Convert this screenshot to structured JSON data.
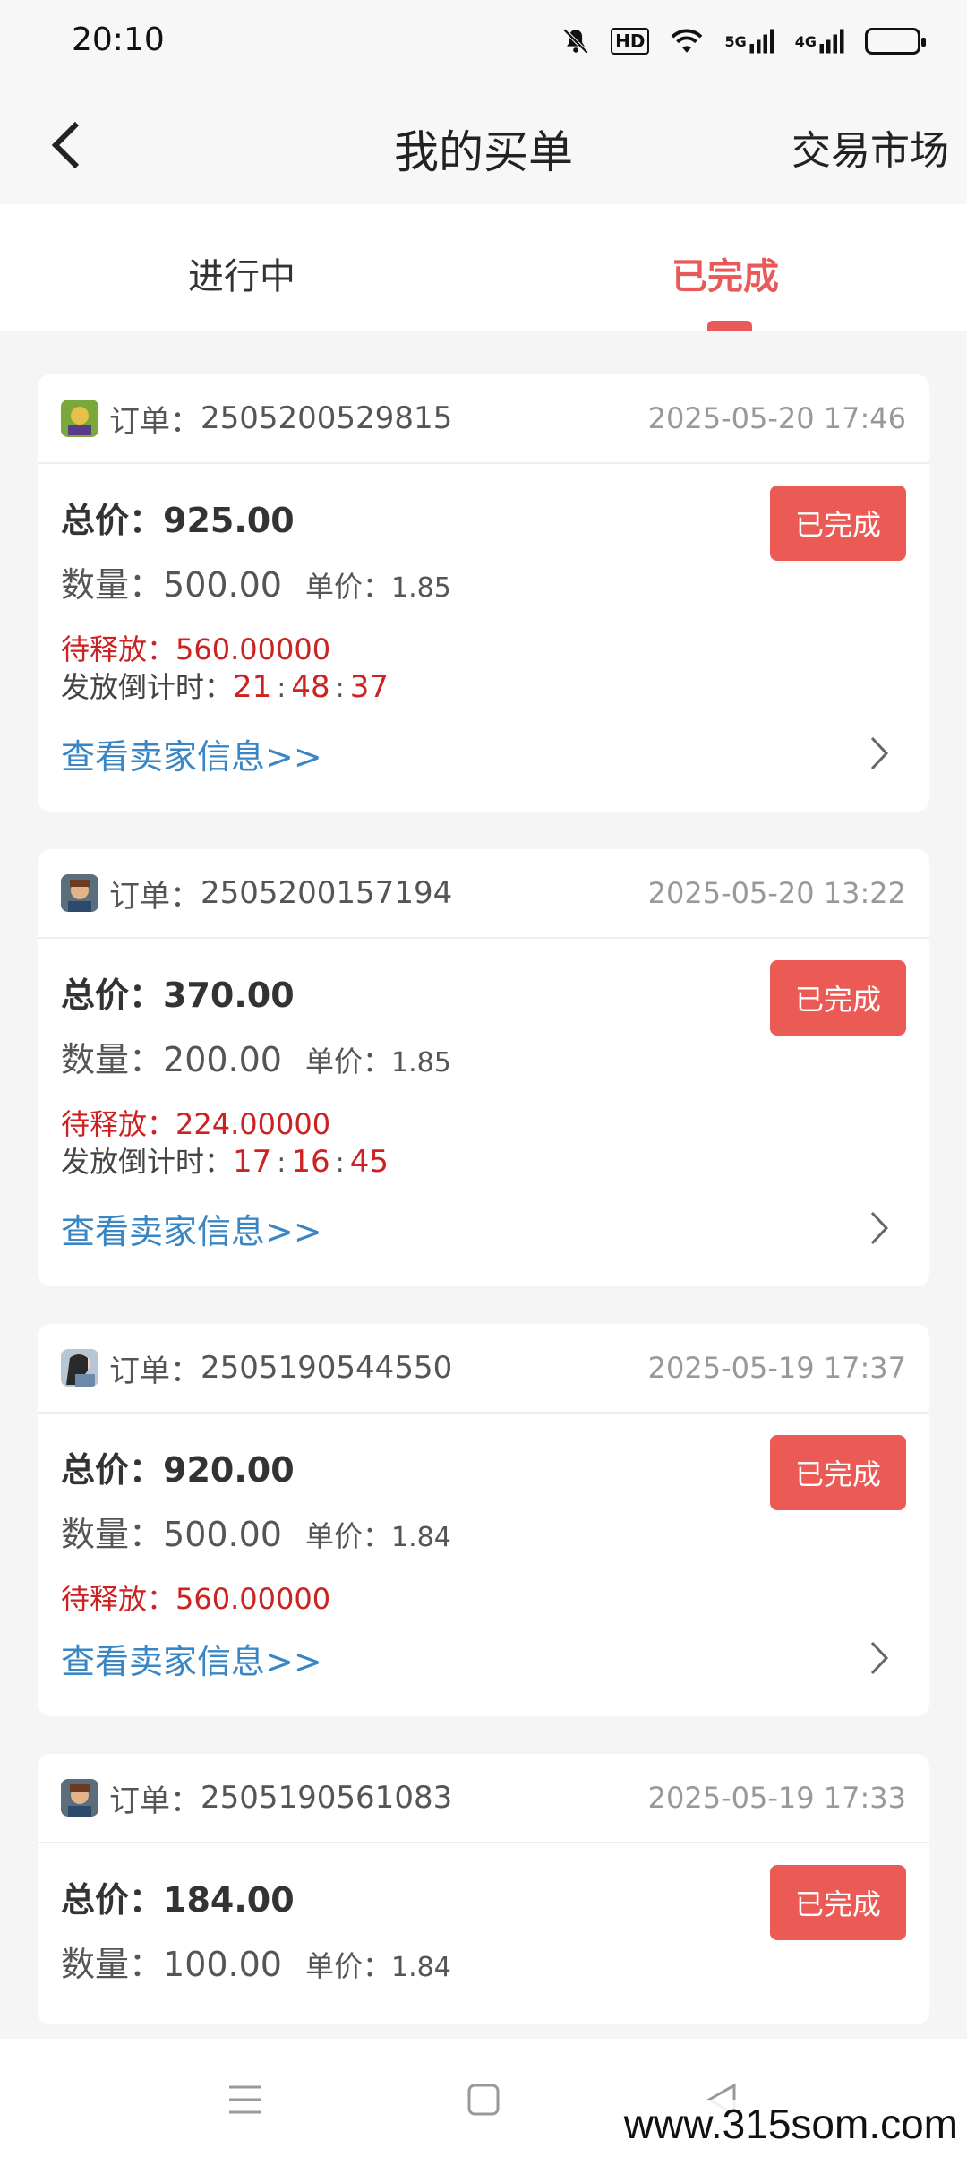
{
  "status_bar": {
    "time": "20:10",
    "icons": [
      "bell-mute-icon",
      "hd-icon",
      "wifi-icon",
      "5g-signal-icon",
      "4g-signal-icon",
      "battery-icon"
    ],
    "hd_label": "HD",
    "signal_5g_label": "5G",
    "signal_4g_label": "4G"
  },
  "header": {
    "title": "我的买单",
    "right_link": "交易市场"
  },
  "tabs": [
    {
      "label": "进行中",
      "active": false
    },
    {
      "label": "已完成",
      "active": true
    }
  ],
  "orders": [
    {
      "order_label": "订单：",
      "order_no": "2505200529815",
      "time": "2025-05-20 17:46",
      "total_label": "总价：",
      "total": "925.00",
      "status": "已完成",
      "qty_label": "数量：",
      "qty": "500.00",
      "price_label": "单价：",
      "price": "1.85",
      "pending_label": "待释放：",
      "pending": "560.00000",
      "countdown_label": "发放倒计时：",
      "countdown": [
        "21",
        "48",
        "37"
      ],
      "seller_link": "查看卖家信息>>"
    },
    {
      "order_label": "订单：",
      "order_no": "2505200157194",
      "time": "2025-05-20 13:22",
      "total_label": "总价：",
      "total": "370.00",
      "status": "已完成",
      "qty_label": "数量：",
      "qty": "200.00",
      "price_label": "单价：",
      "price": "1.85",
      "pending_label": "待释放：",
      "pending": "224.00000",
      "countdown_label": "发放倒计时：",
      "countdown": [
        "17",
        "16",
        "45"
      ],
      "seller_link": "查看卖家信息>>"
    },
    {
      "order_label": "订单：",
      "order_no": "2505190544550",
      "time": "2025-05-19 17:37",
      "total_label": "总价：",
      "total": "920.00",
      "status": "已完成",
      "qty_label": "数量：",
      "qty": "500.00",
      "price_label": "单价：",
      "price": "1.84",
      "pending_label": "待释放：",
      "pending": "560.00000",
      "seller_link": "查看卖家信息>>"
    },
    {
      "order_label": "订单：",
      "order_no": "2505190561083",
      "time": "2025-05-19 17:33",
      "total_label": "总价：",
      "total": "184.00",
      "status": "已完成",
      "qty_label": "数量：",
      "qty": "100.00",
      "price_label": "单价：",
      "price": "1.84"
    }
  ],
  "nav_bar": {
    "icons": [
      "menu-icon",
      "home-square-icon",
      "back-triangle-icon"
    ]
  },
  "watermark": "www.315som.com",
  "colors": {
    "accent": "#e85a5a",
    "status_button": "#ec5a56",
    "pending_text": "#cc2222",
    "link": "#3a86c4"
  }
}
